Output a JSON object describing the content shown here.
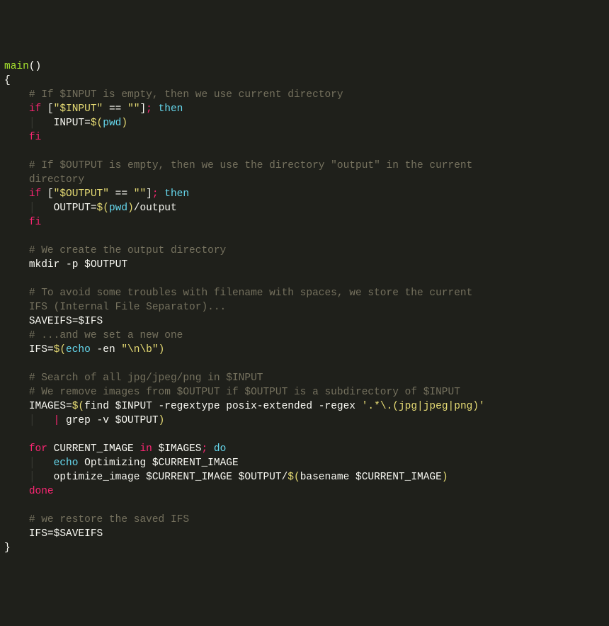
{
  "code": {
    "lines": [
      [
        {
          "t": "main",
          "c": "c-fn"
        },
        {
          "t": "()",
          "c": "c-def"
        }
      ],
      [
        {
          "t": "{",
          "c": "c-def"
        }
      ],
      [
        {
          "t": "    ",
          "c": ""
        },
        {
          "t": "# If $INPUT is empty, then we use current directory",
          "c": "c-com"
        }
      ],
      [
        {
          "t": "    ",
          "c": ""
        },
        {
          "t": "if ",
          "c": "c-kw"
        },
        {
          "t": "[",
          "c": "c-def"
        },
        {
          "t": "\"$INPUT\"",
          "c": "c-str"
        },
        {
          "t": " == ",
          "c": "c-def"
        },
        {
          "t": "\"\"",
          "c": "c-str"
        },
        {
          "t": "]",
          "c": "c-def"
        },
        {
          "t": "; ",
          "c": "c-kw"
        },
        {
          "t": "then",
          "c": "c-cmd"
        }
      ],
      [
        {
          "t": "    ",
          "c": ""
        },
        {
          "t": "│   ",
          "c": "guide"
        },
        {
          "t": "INPUT=",
          "c": "c-def"
        },
        {
          "t": "$(",
          "c": "c-dol"
        },
        {
          "t": "pwd",
          "c": "c-cmd"
        },
        {
          "t": ")",
          "c": "c-dol"
        }
      ],
      [
        {
          "t": "    ",
          "c": ""
        },
        {
          "t": "fi",
          "c": "c-kw"
        }
      ],
      [
        {
          "t": "",
          "c": ""
        }
      ],
      [
        {
          "t": "    ",
          "c": ""
        },
        {
          "t": "# If $OUTPUT is empty, then we use the directory \"output\" in the current ",
          "c": "c-com"
        }
      ],
      [
        {
          "t": "    ",
          "c": ""
        },
        {
          "t": "directory",
          "c": "c-com"
        }
      ],
      [
        {
          "t": "    ",
          "c": ""
        },
        {
          "t": "if ",
          "c": "c-kw"
        },
        {
          "t": "[",
          "c": "c-def"
        },
        {
          "t": "\"$OUTPUT\"",
          "c": "c-str"
        },
        {
          "t": " == ",
          "c": "c-def"
        },
        {
          "t": "\"\"",
          "c": "c-str"
        },
        {
          "t": "]",
          "c": "c-def"
        },
        {
          "t": "; ",
          "c": "c-kw"
        },
        {
          "t": "then",
          "c": "c-cmd"
        }
      ],
      [
        {
          "t": "    ",
          "c": ""
        },
        {
          "t": "│   ",
          "c": "guide"
        },
        {
          "t": "OUTPUT=",
          "c": "c-def"
        },
        {
          "t": "$(",
          "c": "c-dol"
        },
        {
          "t": "pwd",
          "c": "c-cmd"
        },
        {
          "t": ")",
          "c": "c-dol"
        },
        {
          "t": "/output",
          "c": "c-def"
        }
      ],
      [
        {
          "t": "    ",
          "c": ""
        },
        {
          "t": "fi",
          "c": "c-kw"
        }
      ],
      [
        {
          "t": "",
          "c": ""
        }
      ],
      [
        {
          "t": "    ",
          "c": ""
        },
        {
          "t": "# We create the output directory",
          "c": "c-com"
        }
      ],
      [
        {
          "t": "    ",
          "c": ""
        },
        {
          "t": "mkdir -p $OUTPUT",
          "c": "c-def"
        }
      ],
      [
        {
          "t": "",
          "c": ""
        }
      ],
      [
        {
          "t": "    ",
          "c": ""
        },
        {
          "t": "# To avoid some troubles with filename with spaces, we store the current ",
          "c": "c-com"
        }
      ],
      [
        {
          "t": "    ",
          "c": ""
        },
        {
          "t": "IFS (Internal File Separator)...",
          "c": "c-com"
        }
      ],
      [
        {
          "t": "    ",
          "c": ""
        },
        {
          "t": "SAVEIFS=$IFS",
          "c": "c-def"
        }
      ],
      [
        {
          "t": "    ",
          "c": ""
        },
        {
          "t": "# ...and we set a new one",
          "c": "c-com"
        }
      ],
      [
        {
          "t": "    ",
          "c": ""
        },
        {
          "t": "IFS=",
          "c": "c-def"
        },
        {
          "t": "$(",
          "c": "c-dol"
        },
        {
          "t": "echo",
          "c": "c-cmd"
        },
        {
          "t": " -en ",
          "c": "c-def"
        },
        {
          "t": "\"\\n\\b\"",
          "c": "c-str"
        },
        {
          "t": ")",
          "c": "c-dol"
        }
      ],
      [
        {
          "t": "",
          "c": ""
        }
      ],
      [
        {
          "t": "    ",
          "c": ""
        },
        {
          "t": "# Search of all jpg/jpeg/png in $INPUT",
          "c": "c-com"
        }
      ],
      [
        {
          "t": "    ",
          "c": ""
        },
        {
          "t": "# We remove images from $OUTPUT if $OUTPUT is a subdirectory of $INPUT",
          "c": "c-com"
        }
      ],
      [
        {
          "t": "    ",
          "c": ""
        },
        {
          "t": "IMAGES=",
          "c": "c-def"
        },
        {
          "t": "$(",
          "c": "c-dol"
        },
        {
          "t": "find $INPUT -regextype posix-extended -regex ",
          "c": "c-def"
        },
        {
          "t": "'.*\\.(jpg|jpeg|png)'",
          "c": "c-str"
        },
        {
          "t": " ",
          "c": "c-def"
        }
      ],
      [
        {
          "t": "    ",
          "c": ""
        },
        {
          "t": "│   ",
          "c": "guide"
        },
        {
          "t": "|",
          "c": "c-kw"
        },
        {
          "t": " grep -v $OUTPUT",
          "c": "c-def"
        },
        {
          "t": ")",
          "c": "c-dol"
        }
      ],
      [
        {
          "t": "",
          "c": ""
        }
      ],
      [
        {
          "t": "    ",
          "c": ""
        },
        {
          "t": "for ",
          "c": "c-kw"
        },
        {
          "t": "CURRENT_IMAGE ",
          "c": "c-def"
        },
        {
          "t": "in ",
          "c": "c-kw"
        },
        {
          "t": "$IMAGES",
          "c": "c-def"
        },
        {
          "t": "; ",
          "c": "c-kw"
        },
        {
          "t": "do",
          "c": "c-cmd"
        }
      ],
      [
        {
          "t": "    ",
          "c": ""
        },
        {
          "t": "│   ",
          "c": "guide"
        },
        {
          "t": "echo",
          "c": "c-cmd"
        },
        {
          "t": " Optimizing $CURRENT_IMAGE",
          "c": "c-def"
        }
      ],
      [
        {
          "t": "    ",
          "c": ""
        },
        {
          "t": "│   ",
          "c": "guide"
        },
        {
          "t": "optimize_image $CURRENT_IMAGE $OUTPUT/",
          "c": "c-def"
        },
        {
          "t": "$(",
          "c": "c-dol"
        },
        {
          "t": "basename $CURRENT_IMAGE",
          "c": "c-def"
        },
        {
          "t": ")",
          "c": "c-dol"
        }
      ],
      [
        {
          "t": "    ",
          "c": ""
        },
        {
          "t": "done",
          "c": "c-kw"
        }
      ],
      [
        {
          "t": "",
          "c": ""
        }
      ],
      [
        {
          "t": "    ",
          "c": ""
        },
        {
          "t": "# we restore the saved IFS",
          "c": "c-com"
        }
      ],
      [
        {
          "t": "    ",
          "c": ""
        },
        {
          "t": "IFS=$SAVEIFS",
          "c": "c-def"
        }
      ],
      [
        {
          "t": "}",
          "c": "c-def"
        }
      ]
    ]
  }
}
